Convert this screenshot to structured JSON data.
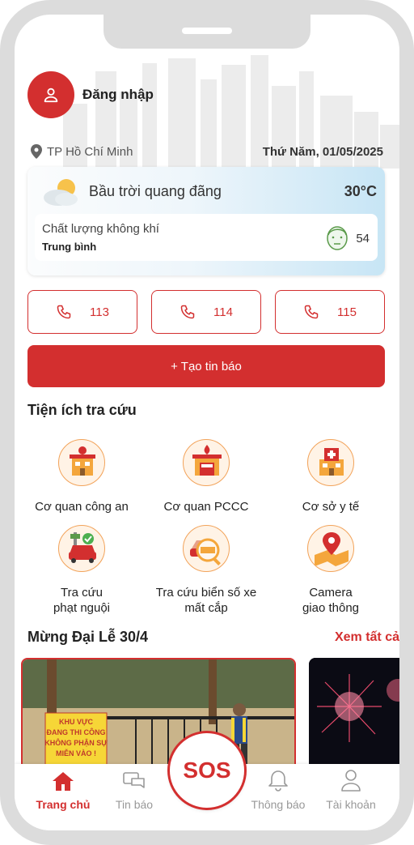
{
  "header": {
    "login_label": "Đăng nhập"
  },
  "location": {
    "city": "TP Hồ Chí Minh",
    "date": "Thứ Năm, 01/05/2025"
  },
  "weather": {
    "description": "Bầu trời quang đãng",
    "temperature": "30°C",
    "air_quality_label": "Chất lượng không khí",
    "air_quality_level": "Trung bình",
    "air_quality_value": "54"
  },
  "hotlines": [
    {
      "number": "113"
    },
    {
      "number": "114"
    },
    {
      "number": "115"
    }
  ],
  "report_button": "+ Tạo tin báo",
  "utilities": {
    "title": "Tiện ích tra cứu",
    "items": [
      {
        "label": "Cơ quan công an",
        "icon": "police-station-icon"
      },
      {
        "label": "Cơ quan PCCC",
        "icon": "fire-station-icon"
      },
      {
        "label": "Cơ sở y tế",
        "icon": "hospital-icon"
      },
      {
        "label": "Tra cứu\nphạt nguội",
        "icon": "traffic-fine-icon"
      },
      {
        "label": "Tra cứu biển số xe\nmất cắp",
        "icon": "stolen-plate-icon"
      },
      {
        "label": "Camera\ngiao thông",
        "icon": "traffic-camera-icon"
      }
    ]
  },
  "news": {
    "title": "Mừng Đại Lễ 30/4",
    "see_all": "Xem tất cả",
    "sign_text": [
      "KHU VỰC",
      "ĐANG THI CÔNG",
      "KHÔNG PHẬN SỰ",
      "MIỄN VÀO !"
    ]
  },
  "tabbar": {
    "items": [
      {
        "label": "Trang chủ",
        "active": true
      },
      {
        "label": "Tin báo",
        "active": false
      },
      {
        "label": "Thông báo",
        "active": false
      },
      {
        "label": "Tài khoản",
        "active": false
      }
    ],
    "sos_label": "SOS"
  },
  "colors": {
    "primary": "#d32f2f",
    "accent_orange": "#f2a35a"
  }
}
